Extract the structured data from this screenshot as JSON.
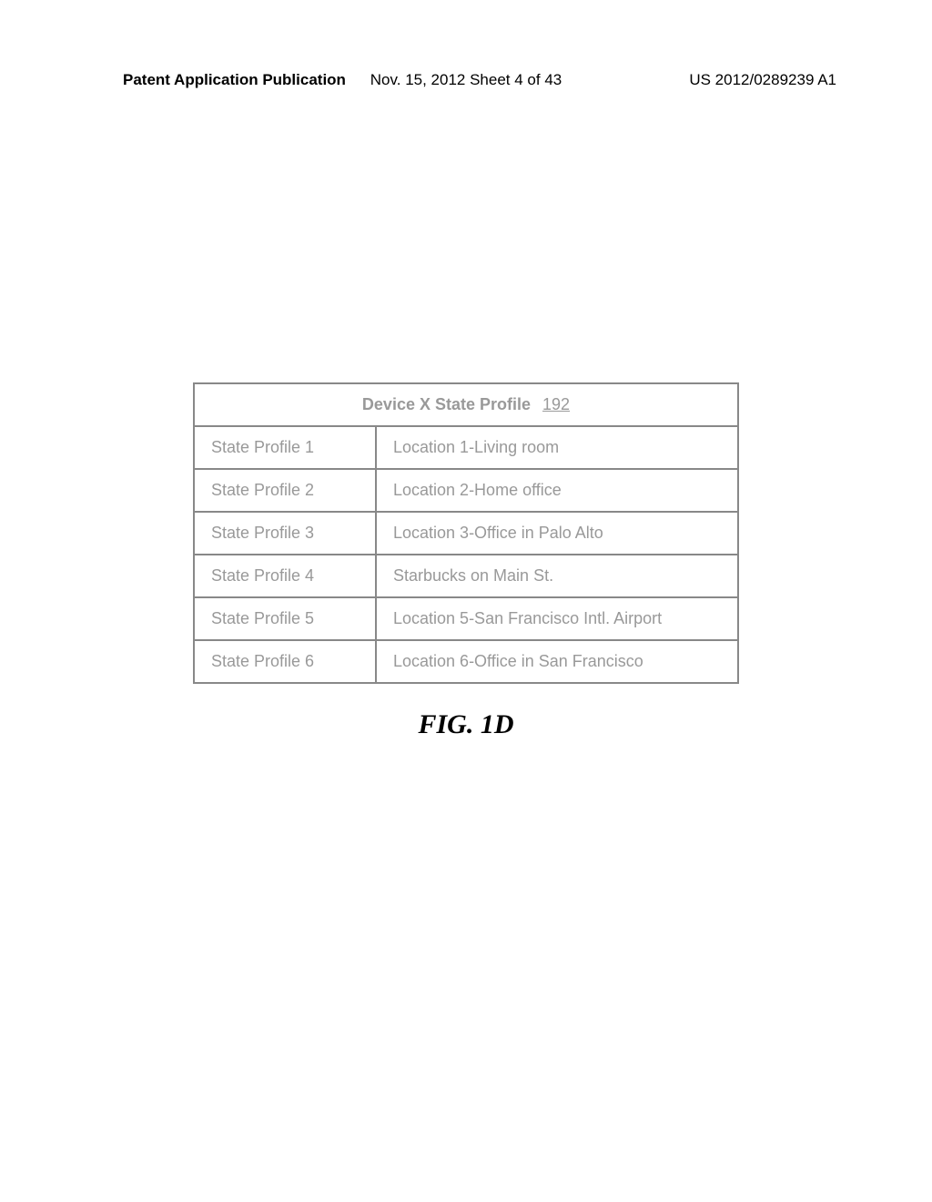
{
  "header": {
    "left": "Patent Application Publication",
    "center": "Nov. 15, 2012  Sheet 4 of 43",
    "right": "US 2012/0289239 A1"
  },
  "table": {
    "title": "Device X State Profile",
    "ref_num": "192",
    "rows": [
      {
        "profile": "State Profile 1",
        "location": "Location 1-Living room"
      },
      {
        "profile": "State Profile 2",
        "location": "Location 2-Home office"
      },
      {
        "profile": "State Profile 3",
        "location": "Location 3-Office in Palo Alto"
      },
      {
        "profile": "State Profile 4",
        "location": "Starbucks on Main St."
      },
      {
        "profile": "State Profile 5",
        "location": "Location 5-San Francisco Intl. Airport"
      },
      {
        "profile": "State Profile 6",
        "location": "Location 6-Office in San Francisco"
      }
    ]
  },
  "caption": "FIG. 1D"
}
